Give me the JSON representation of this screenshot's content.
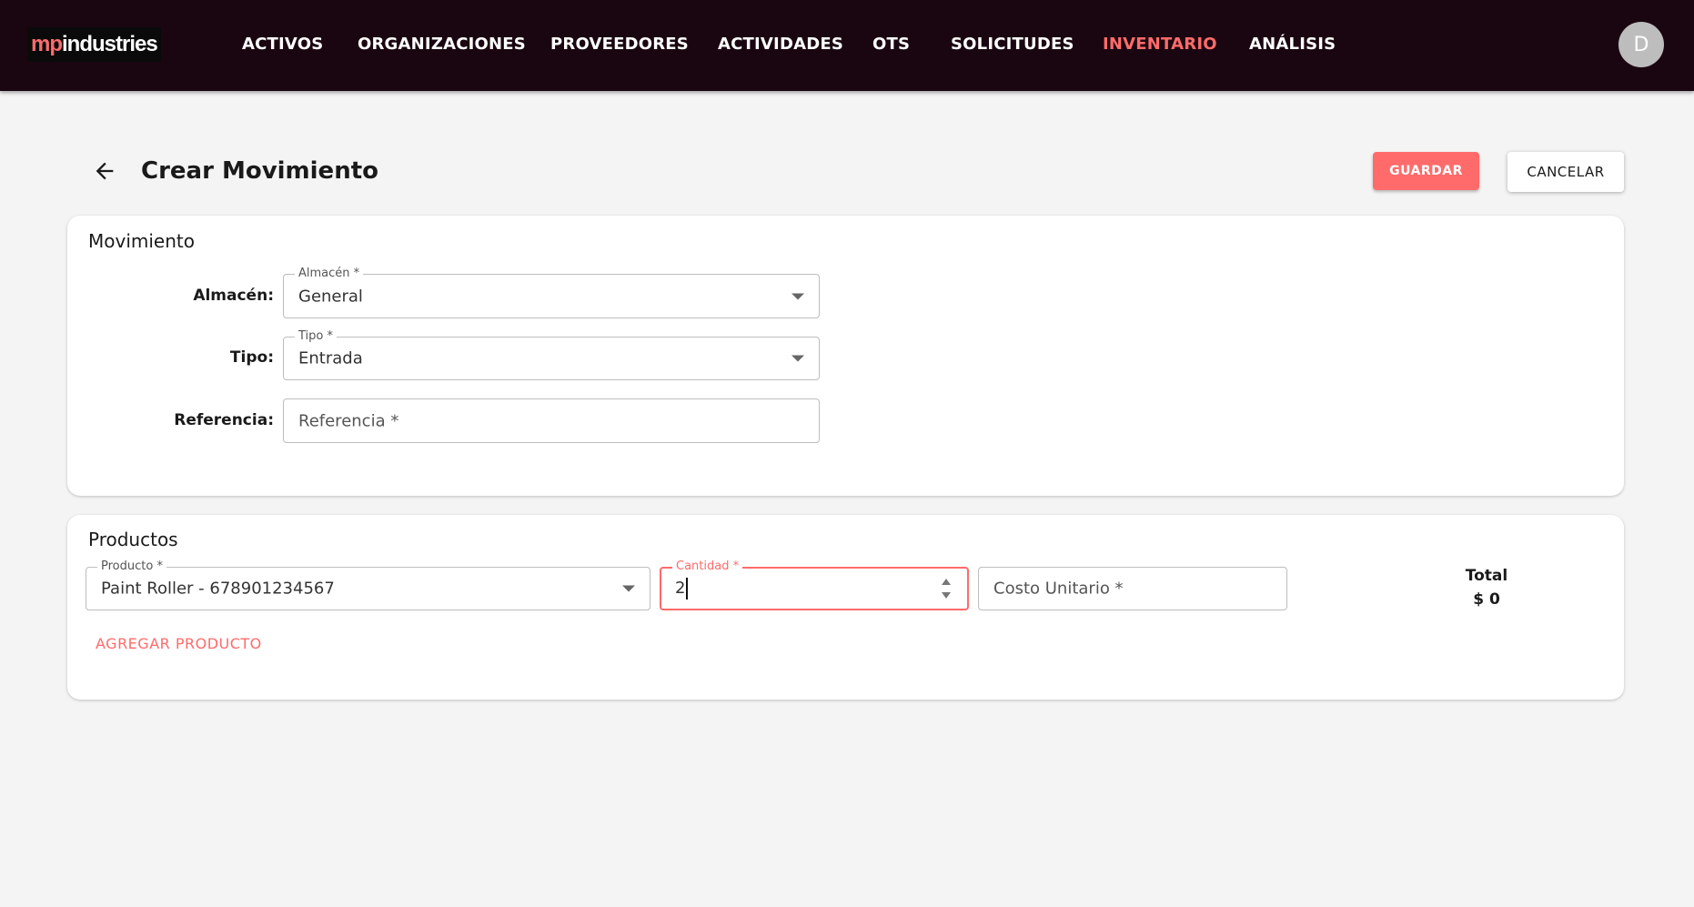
{
  "brand": {
    "part1": "mp",
    "part2": "industries"
  },
  "nav": {
    "items": [
      {
        "label": "ACTIVOS"
      },
      {
        "label": "ORGANIZACIONES"
      },
      {
        "label": "PROVEEDORES"
      },
      {
        "label": "ACTIVIDADES"
      },
      {
        "label": "OTS"
      },
      {
        "label": "SOLICITUDES"
      },
      {
        "label": "INVENTARIO",
        "active": true
      },
      {
        "label": "ANÁLISIS"
      }
    ],
    "avatar_initial": "D"
  },
  "header": {
    "back_icon": "arrow-left-icon",
    "title": "Crear Movimiento",
    "save_label": "GUARDAR",
    "cancel_label": "CANCELAR"
  },
  "movimiento": {
    "section_title": "Movimiento",
    "almacen": {
      "label": "Almacén:",
      "legend": "Almacén *",
      "value": "General"
    },
    "tipo": {
      "label": "Tipo:",
      "legend": "Tipo *",
      "value": "Entrada"
    },
    "referencia": {
      "label": "Referencia:",
      "placeholder": "Referencia *",
      "value": ""
    }
  },
  "productos": {
    "section_title": "Productos",
    "producto": {
      "legend": "Producto *",
      "value": "Paint Roller - 678901234567"
    },
    "cantidad": {
      "legend": "Cantidad *",
      "value": "2"
    },
    "costo_unitario": {
      "placeholder": "Costo Unitario *",
      "value": ""
    },
    "total_label": "Total",
    "total_value": "$ 0",
    "add_label": "AGREGAR PRODUCTO"
  },
  "colors": {
    "accent": "#ff6b6b",
    "topbar": "#1a0610",
    "background": "#f4f4f4"
  }
}
